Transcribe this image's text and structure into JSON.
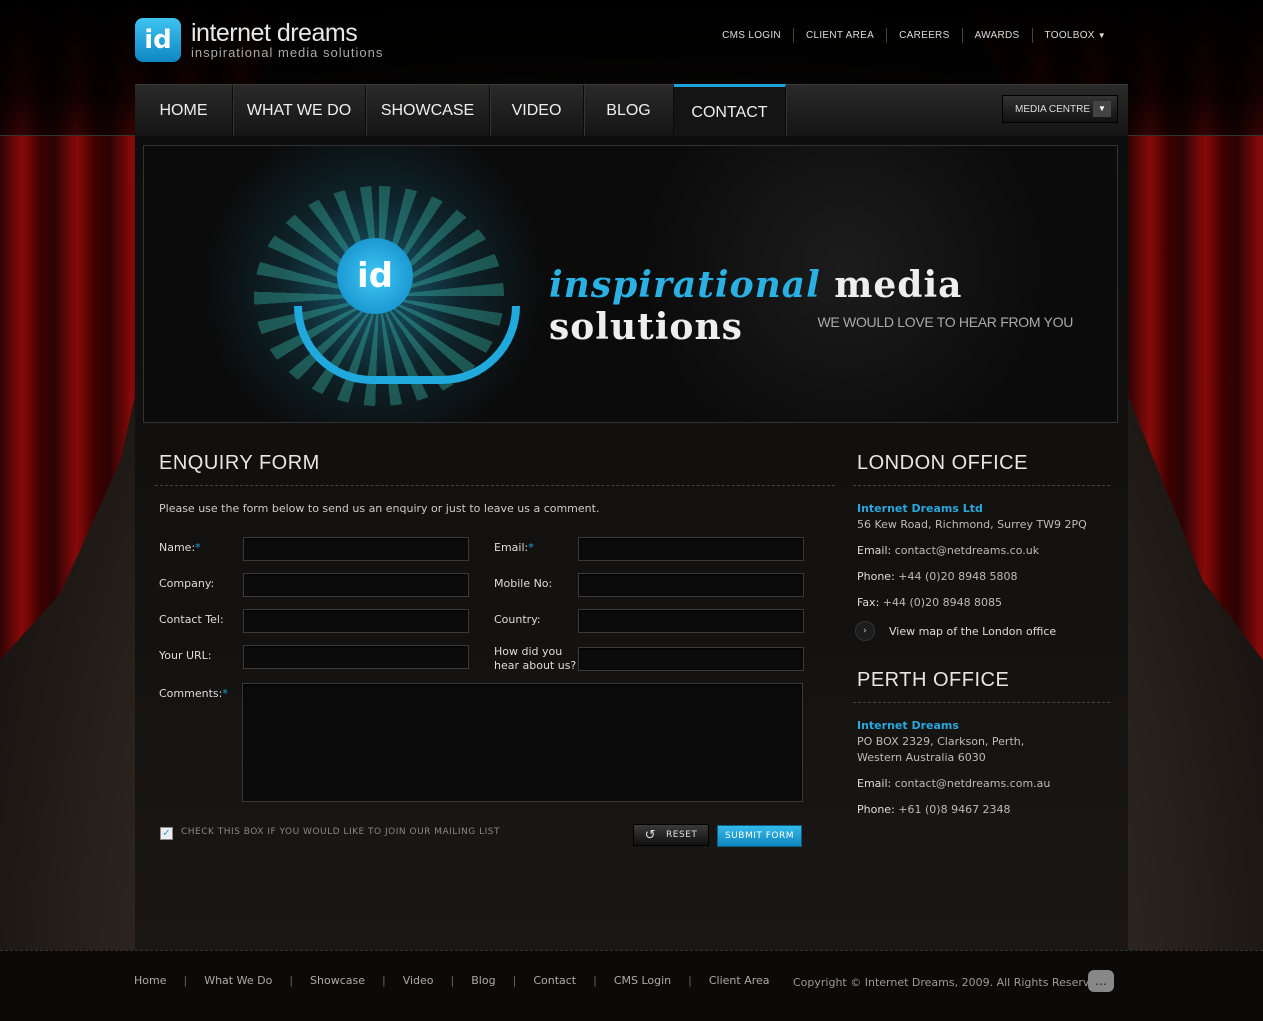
{
  "header": {
    "logo_mark": "id",
    "brand_name": "internet dreams",
    "brand_tagline": "inspirational media solutions",
    "top_links": [
      "CMS LOGIN",
      "CLIENT AREA",
      "CAREERS",
      "AWARDS",
      "TOOLBOX"
    ]
  },
  "nav": {
    "items": [
      "HOME",
      "WHAT WE DO",
      "SHOWCASE",
      "VIDEO",
      "BLOG",
      "CONTACT"
    ],
    "active": "CONTACT",
    "media_centre": "MEDIA CENTRE"
  },
  "banner": {
    "title_part1": "inspirational",
    "title_part2": "media solutions",
    "subtitle": "WE WOULD LOVE TO HEAR FROM YOU"
  },
  "form": {
    "heading": "ENQUIRY FORM",
    "intro": "Please use the form below to send us an enquiry or just to leave us a comment.",
    "labels": {
      "name": "Name:",
      "email": "Email:",
      "company": "Company:",
      "mobile": "Mobile No:",
      "tel": "Contact Tel:",
      "country": "Country:",
      "url": "Your URL:",
      "hear1": "How did you",
      "hear2": "hear about us?",
      "comments": "Comments:"
    },
    "required_mark": "*",
    "mailing_list_label": "CHECK THIS BOX IF YOU WOULD LIKE TO JOIN OUR MAILING LIST",
    "mailing_list_checked": true,
    "reset_label": "RESET",
    "submit_label": "SUBMIT FORM"
  },
  "london": {
    "heading": "LONDON OFFICE",
    "company": "Internet Dreams Ltd",
    "address": "56 Kew Road, Richmond, Surrey TW9 2PQ",
    "email_key": "Email:",
    "email": "contact@netdreams.co.uk",
    "phone_key": "Phone:",
    "phone": "+44 (0)20 8948 5808",
    "fax_key": "Fax:",
    "fax": "+44 (0)20 8948 8085",
    "map_link": "View map of the London office"
  },
  "perth": {
    "heading": "PERTH OFFICE",
    "company": "Internet Dreams",
    "address1": "PO BOX 2329, Clarkson, Perth,",
    "address2": "Western Australia 6030",
    "email_key": "Email:",
    "email": "contact@netdreams.com.au",
    "phone_key": "Phone:",
    "phone": "+61 (0)8 9467 2348"
  },
  "footer": {
    "links": [
      "Home",
      "What We Do",
      "Showcase",
      "Video",
      "Blog",
      "Contact",
      "CMS Login",
      "Client Area"
    ],
    "copyright": "Copyright © Internet Dreams, 2009. All Rights Reserved."
  },
  "colors": {
    "accent": "#1ea3d8",
    "curtain": "#8a0c0c"
  }
}
